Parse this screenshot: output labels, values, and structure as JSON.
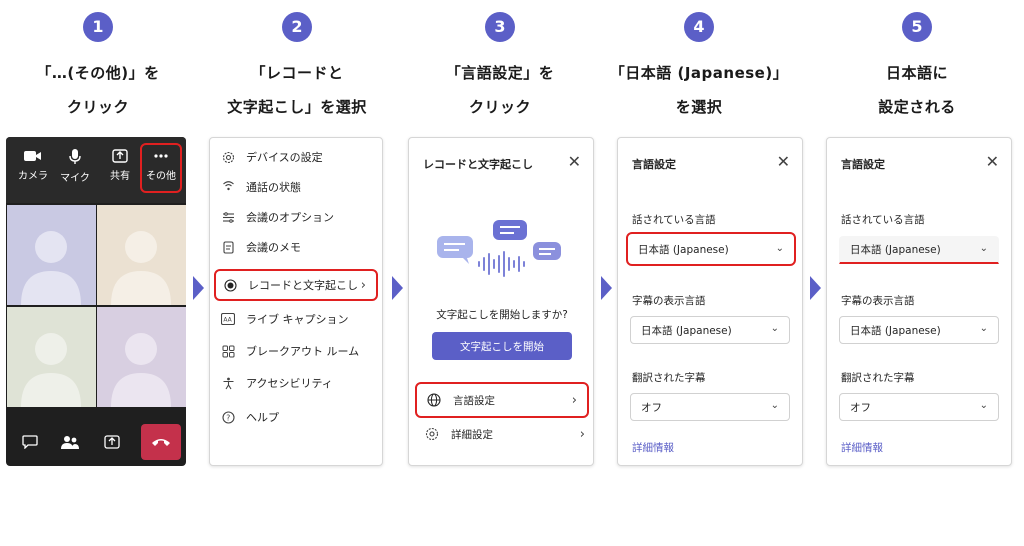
{
  "steps": [
    {
      "number": "1",
      "caption_line1": "「…(その他)」を",
      "caption_line2": "クリック"
    },
    {
      "number": "2",
      "caption_line1": "「レコードと",
      "caption_line2": "文字起こし」を選択"
    },
    {
      "number": "3",
      "caption_line1": "「言語設定」を",
      "caption_line2": "クリック"
    },
    {
      "number": "4",
      "caption_line1": "「日本語 (Japanese)」",
      "caption_line2": "を選択"
    },
    {
      "number": "5",
      "caption_line1": "日本語に",
      "caption_line2": "設定される"
    }
  ],
  "call_toolbar": {
    "camera": "カメラ",
    "mic": "マイク",
    "share": "共有",
    "more": "その他"
  },
  "menu": {
    "items": [
      {
        "label": "デバイスの設定",
        "icon": "gear-icon"
      },
      {
        "label": "通話の状態",
        "icon": "signal-icon"
      },
      {
        "label": "会議のオプション",
        "icon": "options-icon"
      },
      {
        "label": "会議のメモ",
        "icon": "notes-icon"
      },
      {
        "label": "レコードと文字起こし",
        "icon": "record-icon"
      },
      {
        "label": "ライブ キャプション",
        "icon": "captions-icon"
      },
      {
        "label": "ブレークアウト ルーム",
        "icon": "breakout-icon"
      },
      {
        "label": "アクセシビリティ",
        "icon": "accessibility-icon"
      },
      {
        "label": "ヘルプ",
        "icon": "help-icon"
      }
    ]
  },
  "record_panel": {
    "title": "レコードと文字起こし",
    "prompt": "文字起こしを開始しますか?",
    "start_button": "文字起こしを開始",
    "language_settings": "言語設定",
    "detail_settings": "詳細設定"
  },
  "lang_panel": {
    "title": "言語設定",
    "spoken_label": "話されている言語",
    "spoken_value": "日本語 (Japanese)",
    "caption_label": "字幕の表示言語",
    "caption_value": "日本語 (Japanese)",
    "translated_label": "翻訳された字幕",
    "translated_value": "オフ",
    "details_link": "詳細情報"
  },
  "colors": {
    "accent": "#5b5fc7",
    "highlight": "#e02020",
    "hangup": "#c4314b"
  }
}
